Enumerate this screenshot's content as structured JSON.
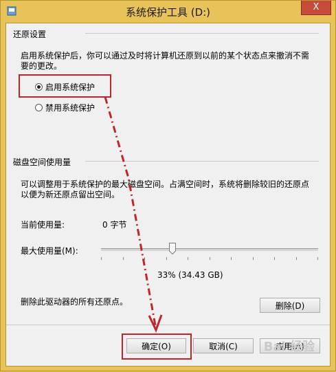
{
  "window": {
    "title": "系统保护工具 (D:)",
    "close_glyph": "X"
  },
  "restore": {
    "group_label": "还原设置",
    "description_line1": "启用系统保护后，你可以通过及时将计算机还原到以前的某个状态点来撤消不需",
    "description_line2": "要的更改。",
    "options": [
      {
        "label": "启用系统保护",
        "selected": true
      },
      {
        "label": "禁用系统保护",
        "selected": false
      }
    ]
  },
  "disk": {
    "group_label": "磁盘空间使用量",
    "description_line1": "可以调整用于系统保护的最大磁盘空间。占满空间时，系统将删除较旧的还原点",
    "description_line2": "以便为新还原点留出空间。",
    "current_label": "当前使用量:",
    "current_value": "0 字节",
    "max_label": "最大使用量(M):",
    "max_fraction": 0.33,
    "max_value_text": "33% (34.43 GB)",
    "delete_text": "删除此驱动器的所有还原点。",
    "delete_button": "删除(D)"
  },
  "footer": {
    "ok_button": "确定(O)",
    "cancel_button": "取消(C)",
    "apply_button": "应用(A)"
  },
  "annotation": {
    "color": "#c0242d"
  },
  "watermark": "Bai 经验"
}
